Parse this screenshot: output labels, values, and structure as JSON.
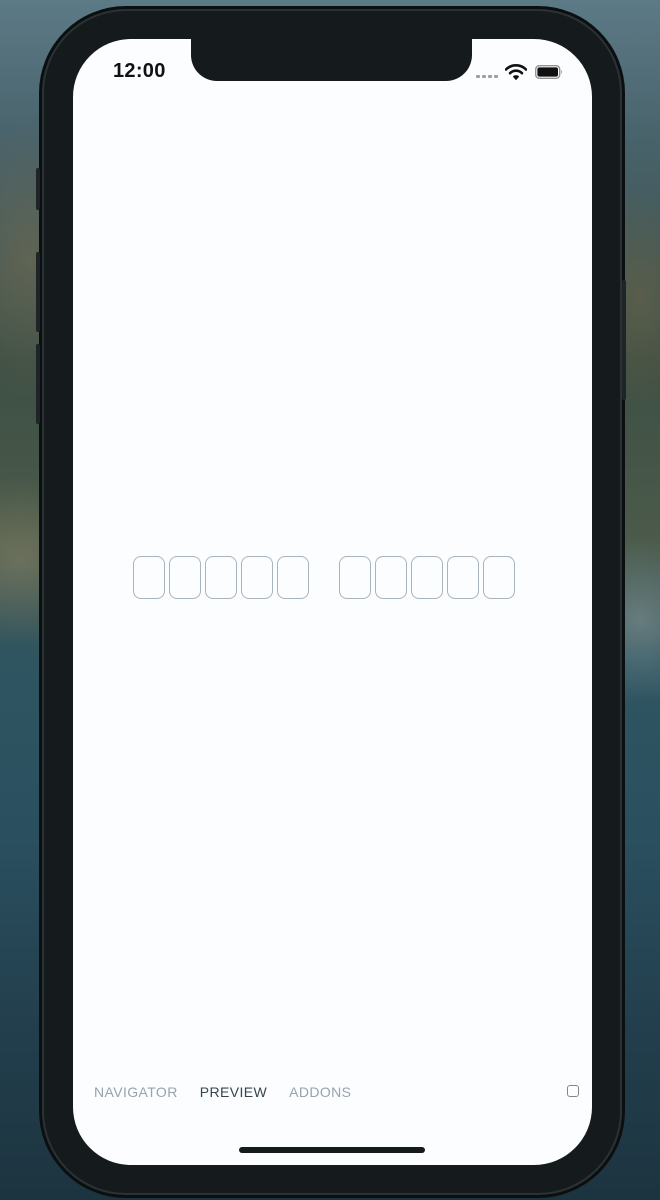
{
  "status_bar": {
    "time": "12:00",
    "icons": [
      "cellular-signal-icon",
      "wifi-icon",
      "battery-icon"
    ]
  },
  "code_input": {
    "groups": [
      {
        "boxes": [
          "",
          "",
          "",
          "",
          ""
        ]
      },
      {
        "boxes": [
          "",
          "",
          "",
          "",
          ""
        ]
      }
    ]
  },
  "addon_panel": {
    "tabs": [
      {
        "label": "NAVIGATOR",
        "active": false
      },
      {
        "label": "PREVIEW",
        "active": true
      },
      {
        "label": "ADDONS",
        "active": false
      }
    ],
    "toggle_checked": false
  },
  "colors": {
    "screen_background": "#fcfdfe",
    "box_border": "#a9b3bc",
    "tab_inactive": "#97a3ad",
    "tab_active": "#37444d",
    "device_frame": "#151a1c"
  }
}
